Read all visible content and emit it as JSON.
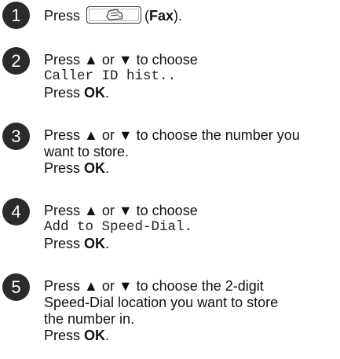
{
  "steps": [
    {
      "number": "1",
      "press": "Press",
      "open_paren": "(",
      "key_name": "Fax",
      "close_paren": ").",
      "icon": "fax-machine-icon"
    },
    {
      "number": "2",
      "line1": "Press ▲ or ▼ to choose",
      "menu_item": "Caller ID hist..",
      "press": "Press ",
      "key": "OK",
      "end": "."
    },
    {
      "number": "3",
      "line1": "Press ▲ or ▼ to choose the number you",
      "line2": "want to store.",
      "press": "Press ",
      "key": "OK",
      "end": "."
    },
    {
      "number": "4",
      "line1": "Press ▲ or ▼ to choose",
      "menu_item": "Add to Speed-Dial.",
      "press": "Press ",
      "key": "OK",
      "end": "."
    },
    {
      "number": "5",
      "line1": "Press ▲ or ▼ to choose the 2-digit",
      "line2": "Speed-Dial location you want to store",
      "line3": "the number in.",
      "press": "Press ",
      "key": "OK",
      "end": "."
    }
  ]
}
